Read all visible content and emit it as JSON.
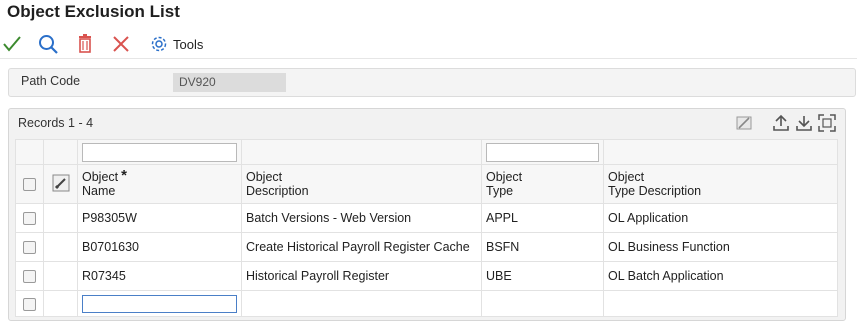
{
  "window": {
    "title": "Object Exclusion List"
  },
  "toolbar": {
    "ok_icon": "check-icon",
    "find_icon": "search-icon",
    "delete_icon": "trash-icon",
    "cancel_icon": "close-icon",
    "tools_icon": "gear-icon",
    "tools_label": "Tools"
  },
  "form": {
    "path_code_label": "Path Code",
    "path_code_value": "DV920"
  },
  "grid": {
    "records_label": "Records 1 - 4",
    "icons": [
      "edit-grid-icon",
      "upload-icon",
      "download-icon",
      "fullscreen-icon"
    ],
    "columns": [
      {
        "line1": "Object",
        "line2": "Name",
        "required": "*"
      },
      {
        "line1": "Object",
        "line2": "Description"
      },
      {
        "line1": "Object",
        "line2": "Type"
      },
      {
        "line1": "Object",
        "line2": "Type Description"
      }
    ],
    "rows": [
      {
        "name": "P98305W",
        "description": "Batch Versions - Web Version",
        "type": "APPL",
        "type_description": "OL Application"
      },
      {
        "name": "B0701630",
        "description": "Create Historical Payroll Register Cache",
        "type": "BSFN",
        "type_description": "OL Business Function"
      },
      {
        "name": "R07345",
        "description": "Historical Payroll Register",
        "type": "UBE",
        "type_description": "OL Batch Application"
      }
    ]
  },
  "colors": {
    "ok": "#3c8a2e",
    "find": "#2a6fc9",
    "delete": "#d9534f",
    "cancel": "#d9534f",
    "tools": "#2a6fc9"
  }
}
